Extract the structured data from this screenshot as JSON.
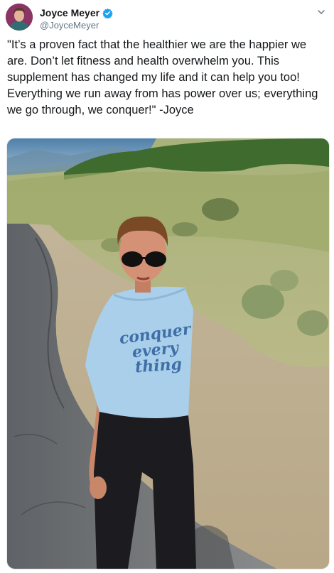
{
  "author": {
    "display_name": "Joyce Meyer",
    "handle": "@JoyceMeyer",
    "verified": true,
    "avatar": "avatar-portrait"
  },
  "tweet": {
    "text": "\"It’s a proven fact that the healthier we are the happier we are. Don’t let fitness and health overwhelm you. This supplement has changed my life and it can help you too! Everything we run away from has power over us; everything we go through, we conquer!\" -Joyce"
  },
  "media": {
    "shirt_text": [
      "conquer",
      "every",
      "thing"
    ]
  },
  "icons": {
    "verified": "verified-badge-icon",
    "menu": "chevron-down-icon"
  },
  "colors": {
    "verified_blue": "#1da1f2",
    "handle_gray": "#657786",
    "text": "#14171a"
  }
}
